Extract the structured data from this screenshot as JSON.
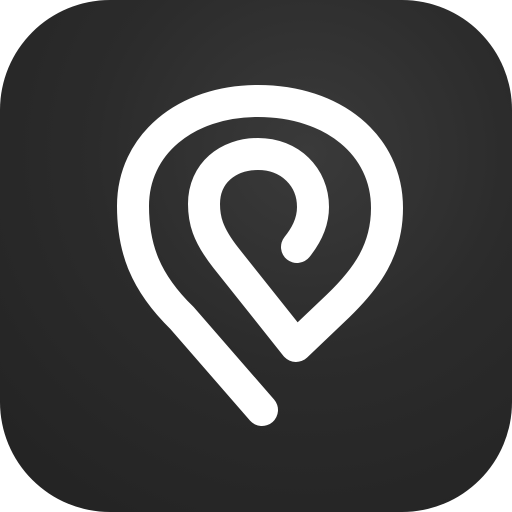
{
  "app_icon": {
    "icon": "map-pin-spiral-icon",
    "colors": {
      "background": "#2b2b2b",
      "glyph": "#ffffff"
    }
  }
}
